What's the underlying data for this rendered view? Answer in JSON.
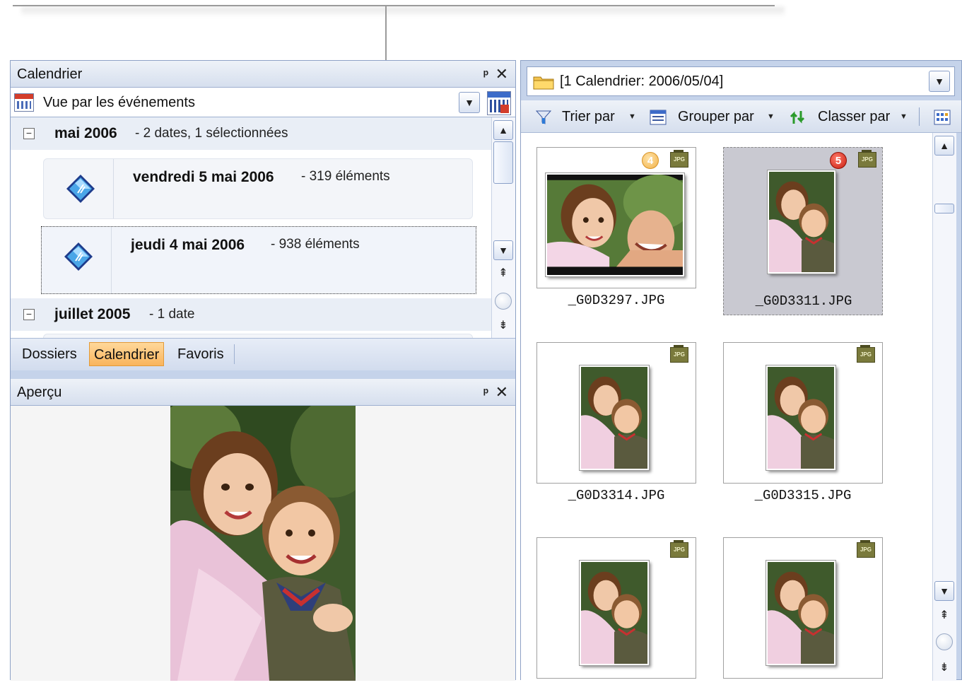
{
  "calendar_panel": {
    "title": "Calendrier",
    "pin_icon": "pin-icon",
    "close_icon": "close-icon",
    "view_select": {
      "value": "Vue par les événements"
    },
    "months": [
      {
        "name": "mai 2006",
        "info": "- 2 dates, 1 sélectionnées",
        "dates": [
          {
            "title": "vendredi 5 mai 2006",
            "info": "- 319 éléments"
          },
          {
            "title": "jeudi 4 mai 2006",
            "info": "- 938 éléments"
          }
        ]
      },
      {
        "name": "juillet 2005",
        "info": "- 1 date"
      }
    ],
    "toggle_symbol": "−"
  },
  "tabs": [
    {
      "label": "Dossiers"
    },
    {
      "label": "Calendrier",
      "active": true
    },
    {
      "label": "Favoris"
    }
  ],
  "preview_panel": {
    "title": "Aperçu"
  },
  "browser": {
    "path": "[1 Calendrier: 2006/05/04]",
    "toolbar": {
      "sort_label": "Trier par",
      "group_label": "Grouper par",
      "classify_label": "Classer par"
    },
    "thumbnails": [
      {
        "filename": "_G0D3297.JPG",
        "badge": "4",
        "badge_color": "#f2b24a",
        "type": "JPG",
        "orientation": "landscape"
      },
      {
        "filename": "_G0D3311.JPG",
        "badge": "5",
        "badge_color": "#c81e10",
        "type": "JPG",
        "orientation": "portrait",
        "selected": true
      },
      {
        "filename": "_G0D3314.JPG",
        "type": "JPG",
        "orientation": "portrait"
      },
      {
        "filename": "_G0D3315.JPG",
        "type": "JPG",
        "orientation": "portrait"
      },
      {
        "filename": "",
        "type": "JPG",
        "orientation": "portrait"
      },
      {
        "filename": "",
        "type": "JPG",
        "orientation": "portrait"
      }
    ]
  },
  "colors": {
    "panel_bg": "#c5d3ea",
    "active_tab": "#f9b45c",
    "selection": "#c9c9d1"
  }
}
